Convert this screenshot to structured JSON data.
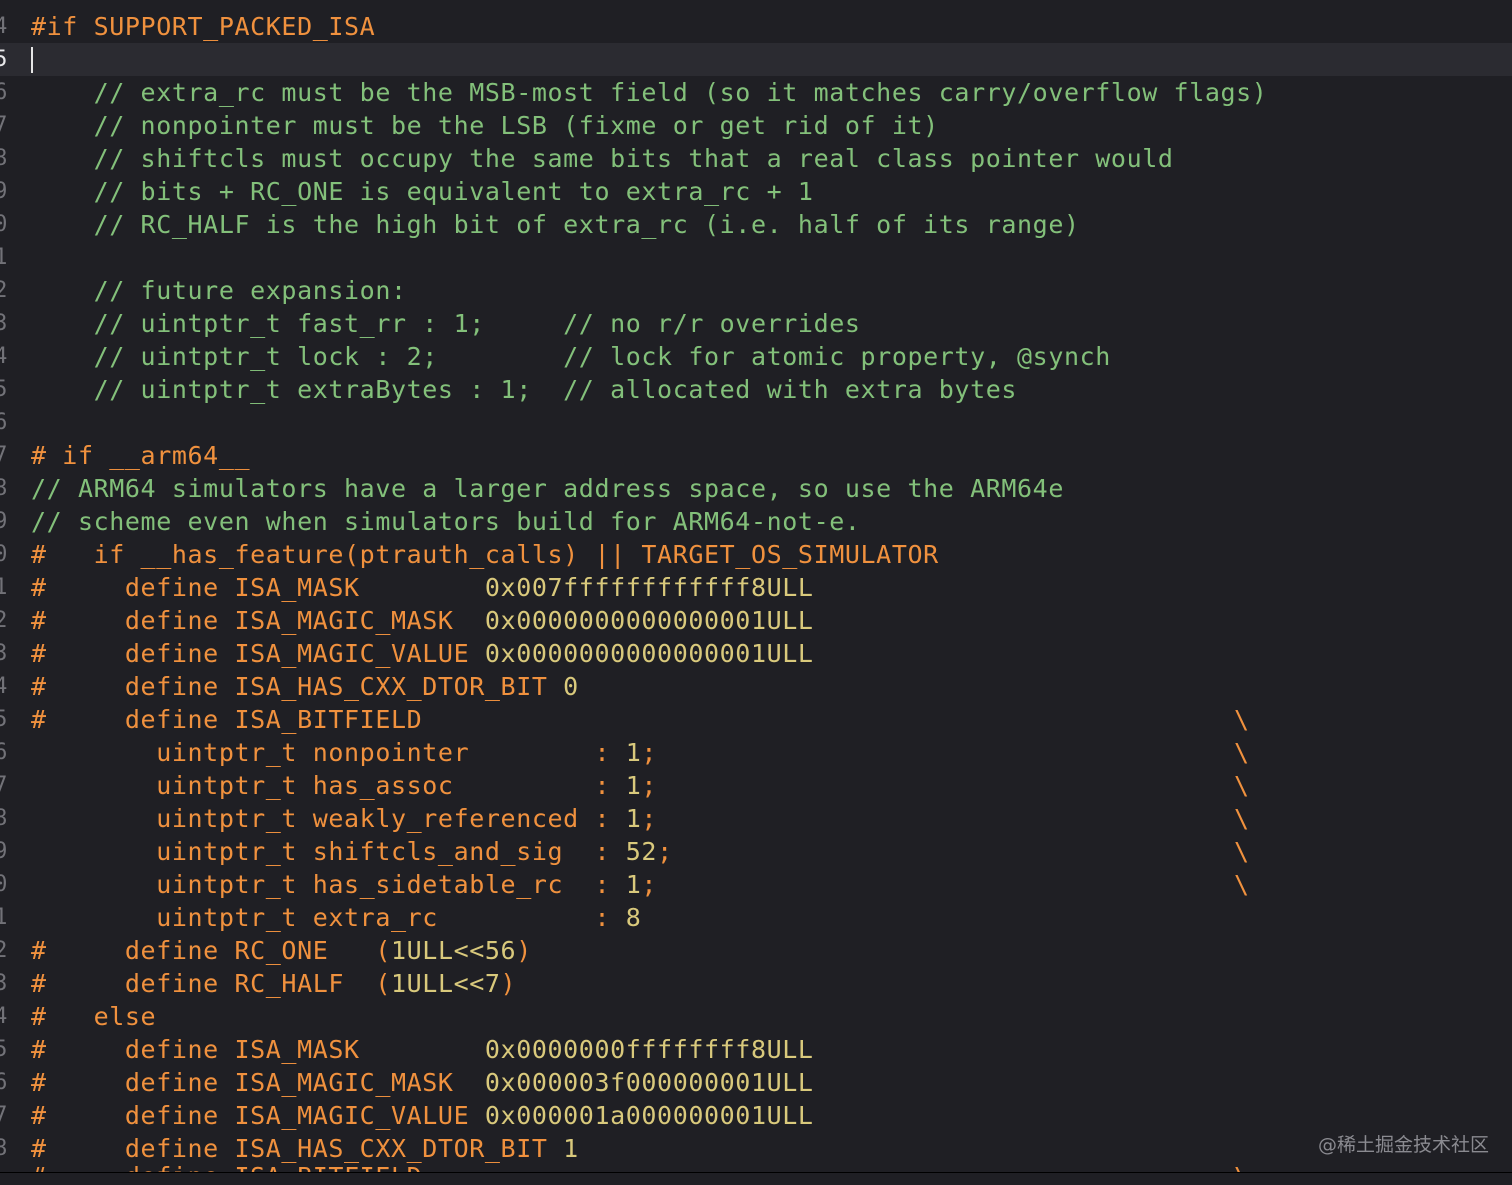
{
  "colors": {
    "background": "#1f1f24",
    "current_line": "#2b2b31",
    "preprocessor": "#f0913e",
    "comment": "#83c07a",
    "number": "#d9c97c",
    "plain": "#e6e6e6"
  },
  "gutter": [
    "4",
    "5",
    "6",
    "7",
    "8",
    "9",
    "0",
    "1",
    "2",
    "3",
    "4",
    "5",
    "6",
    "7",
    "8",
    "9",
    "0",
    "1",
    "2",
    "3",
    "4",
    "5",
    "6",
    "7",
    "8",
    "9",
    "0",
    "1",
    "2",
    "3",
    "4",
    "5",
    "6",
    "7",
    "8"
  ],
  "lines": {
    "l0": "#if SUPPORT_PACKED_ISA",
    "l2": "    // extra_rc must be the MSB-most field (so it matches carry/overflow flags)",
    "l3": "    // nonpointer must be the LSB (fixme or get rid of it)",
    "l4": "    // shiftcls must occupy the same bits that a real class pointer would",
    "l5": "    // bits + RC_ONE is equivalent to extra_rc + 1",
    "l6": "    // RC_HALF is the high bit of extra_rc (i.e. half of its range)",
    "l8": "    // future expansion:",
    "l9": "    // uintptr_t fast_rr : 1;     // no r/r overrides",
    "l10": "    // uintptr_t lock : 2;        // lock for atomic property, @synch",
    "l11": "    // uintptr_t extraBytes : 1;  // allocated with extra bytes",
    "l13": "# if __arm64__",
    "l14": "// ARM64 simulators have a larger address space, so use the ARM64e",
    "l15": "// scheme even when simulators build for ARM64-not-e.",
    "l16": "#   if __has_feature(ptrauth_calls) || TARGET_OS_SIMULATOR",
    "l17a": "#     define ISA_MASK        ",
    "l17b": "0x007ffffffffffff8ULL",
    "l18a": "#     define ISA_MAGIC_MASK  ",
    "l18b": "0x0000000000000001ULL",
    "l19a": "#     define ISA_MAGIC_VALUE ",
    "l19b": "0x0000000000000001ULL",
    "l20a": "#     define ISA_HAS_CXX_DTOR_BIT ",
    "l20b": "0",
    "l21": "#     define ISA_BITFIELD",
    "l22a": "        uintptr_t nonpointer        : ",
    "l22b": "1",
    "l23a": "        uintptr_t has_assoc         : ",
    "l23b": "1",
    "l24a": "        uintptr_t weakly_referenced : ",
    "l24b": "1",
    "l25a": "        uintptr_t shiftcls_and_sig  : ",
    "l25b": "52",
    "l26a": "        uintptr_t has_sidetable_rc  : ",
    "l26b": "1",
    "l27a": "        uintptr_t extra_rc          : ",
    "l27b": "8",
    "l28a": "#     define RC_ONE   (",
    "l28b": "1ULL<<56",
    "l29a": "#     define RC_HALF  (",
    "l29b": "1ULL<<7",
    "l30": "#   else",
    "l31a": "#     define ISA_MASK        ",
    "l31b": "0x0000000ffffffff8ULL",
    "l32a": "#     define ISA_MAGIC_MASK  ",
    "l32b": "0x000003f000000001ULL",
    "l33a": "#     define ISA_MAGIC_VALUE ",
    "l33b": "0x000001a000000001ULL",
    "l34a": "#     define ISA_HAS_CXX_DTOR_BIT ",
    "l34b": "1",
    "l35": "#     define ISA_BITFIELD",
    "semicolon": ";",
    "close_paren": ")",
    "backslash": "\\"
  },
  "watermark": "@稀土掘金技术社区"
}
